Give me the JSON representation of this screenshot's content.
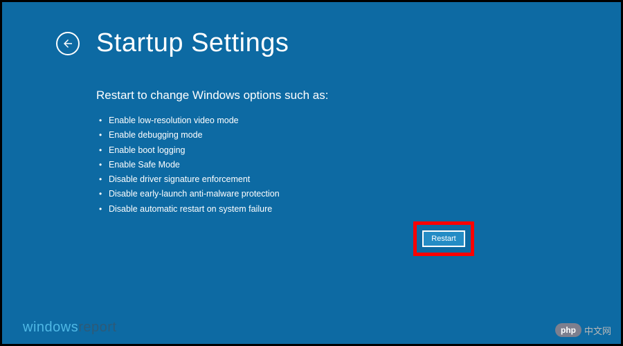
{
  "header": {
    "title": "Startup Settings"
  },
  "subtitle": "Restart to change Windows options such as:",
  "options": [
    "Enable low-resolution video mode",
    "Enable debugging mode",
    "Enable boot logging",
    "Enable Safe Mode",
    "Disable driver signature enforcement",
    "Disable early-launch anti-malware protection",
    "Disable automatic restart on system failure"
  ],
  "restart_button": "Restart",
  "watermark_left": {
    "part1": "windows",
    "part2": "report"
  },
  "watermark_right": {
    "badge": "php",
    "text": "中文网"
  }
}
